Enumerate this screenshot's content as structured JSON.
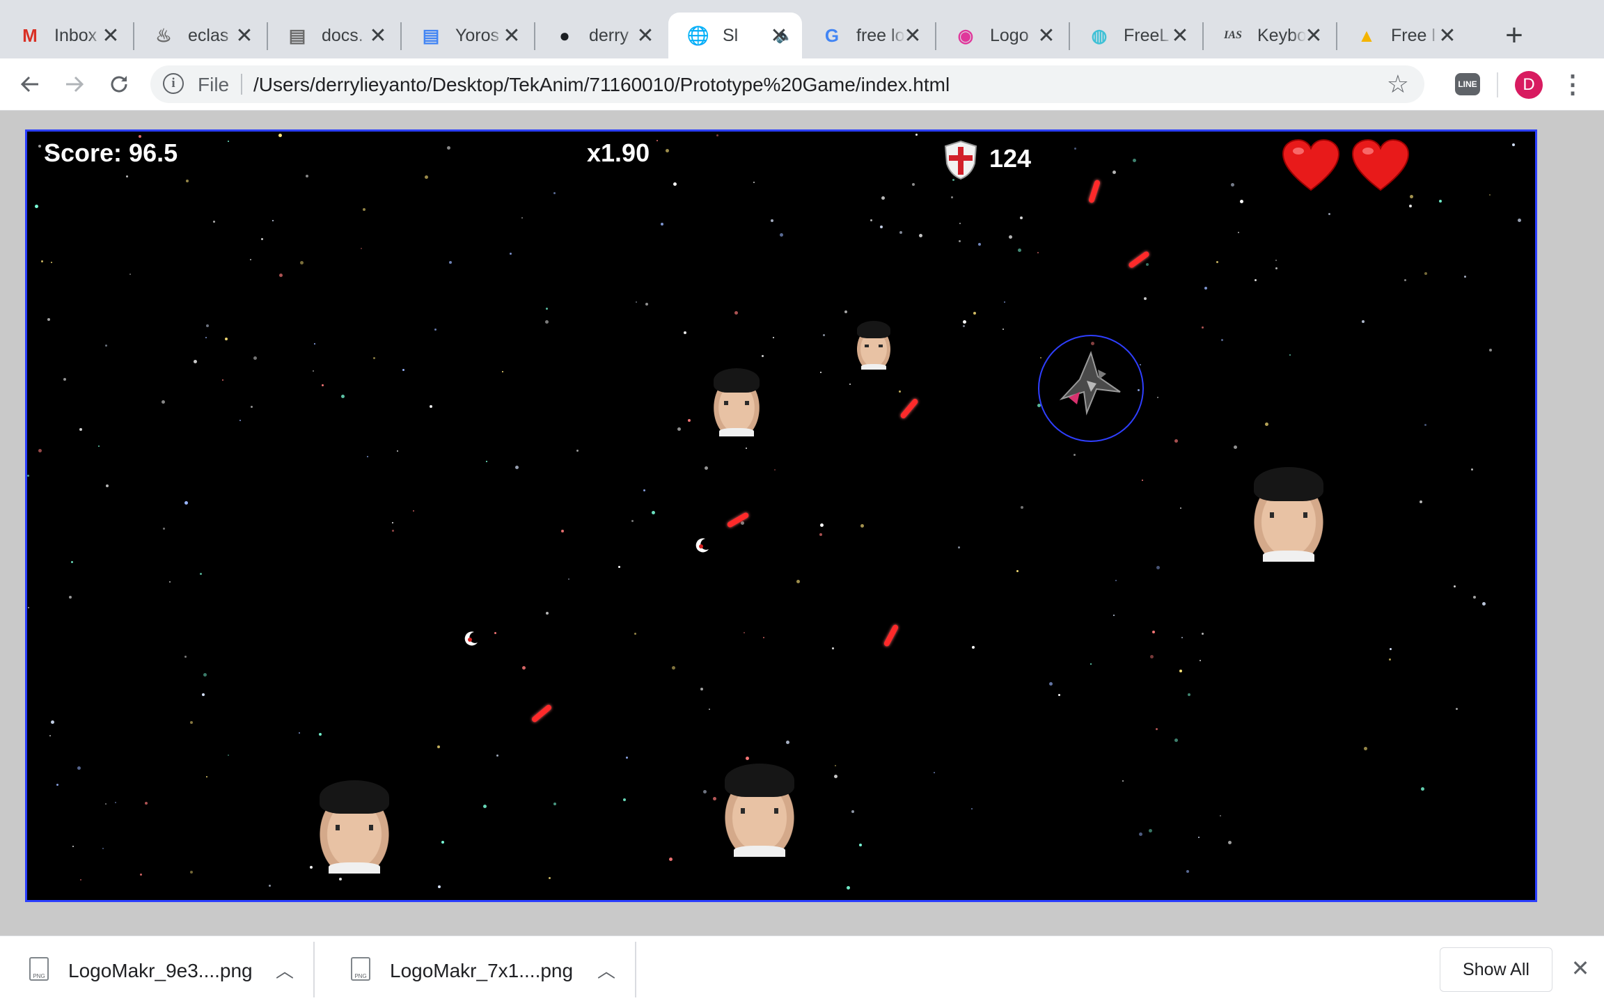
{
  "tabs": [
    {
      "title": "Inbox",
      "icon": "gmail-icon",
      "glyph": "M",
      "color": "#d93025",
      "active": false
    },
    {
      "title": "eclas",
      "icon": "eclass-icon",
      "glyph": "♨",
      "color": "#6a6a6a",
      "active": false
    },
    {
      "title": "docs.",
      "icon": "docs-page-icon",
      "glyph": "▤",
      "color": "#6a6a6a",
      "active": false
    },
    {
      "title": "Yoros",
      "icon": "google-docs-icon",
      "glyph": "▤",
      "color": "#4285f4",
      "active": false
    },
    {
      "title": "derry",
      "icon": "github-icon",
      "glyph": "●",
      "color": "#1b1f23",
      "active": false
    },
    {
      "title": "Sl",
      "icon": "globe-icon",
      "glyph": "🌐",
      "color": "#3c4043",
      "active": true,
      "audio": "🔈"
    },
    {
      "title": "free lo",
      "icon": "google-icon",
      "glyph": "G",
      "color": "#4285f4",
      "active": false
    },
    {
      "title": "Logo",
      "icon": "logomakr-icon",
      "glyph": "◉",
      "color": "#e0379b",
      "active": false
    },
    {
      "title": "FreeL",
      "icon": "freelogodesign-icon",
      "glyph": "◍",
      "color": "#3fc1d6",
      "active": false
    },
    {
      "title": "Keybo",
      "icon": "ias-icon",
      "glyph": "IAS",
      "color": "#3c4043",
      "active": false
    },
    {
      "title": "Free l",
      "icon": "shapes-icon",
      "glyph": "▲",
      "color": "#f4b400",
      "active": false
    }
  ],
  "newtab_label": "+",
  "toolbar": {
    "scheme": "File",
    "url": "/Users/derrylieyanto/Desktop/TekAnim/71160010/Prototype%20Game/index.html",
    "avatar_letter": "D",
    "ext_label": "LINE"
  },
  "game": {
    "score_text": "Score: 96.5",
    "multiplier_text": "x1.90",
    "shield_value": "124",
    "lives": 2
  },
  "downloads": [
    {
      "name": "LogoMakr_9e3....png",
      "type_label": "PNG"
    },
    {
      "name": "LogoMakr_7x1....png",
      "type_label": "PNG"
    }
  ],
  "shelf": {
    "show_all_label": "Show All"
  }
}
